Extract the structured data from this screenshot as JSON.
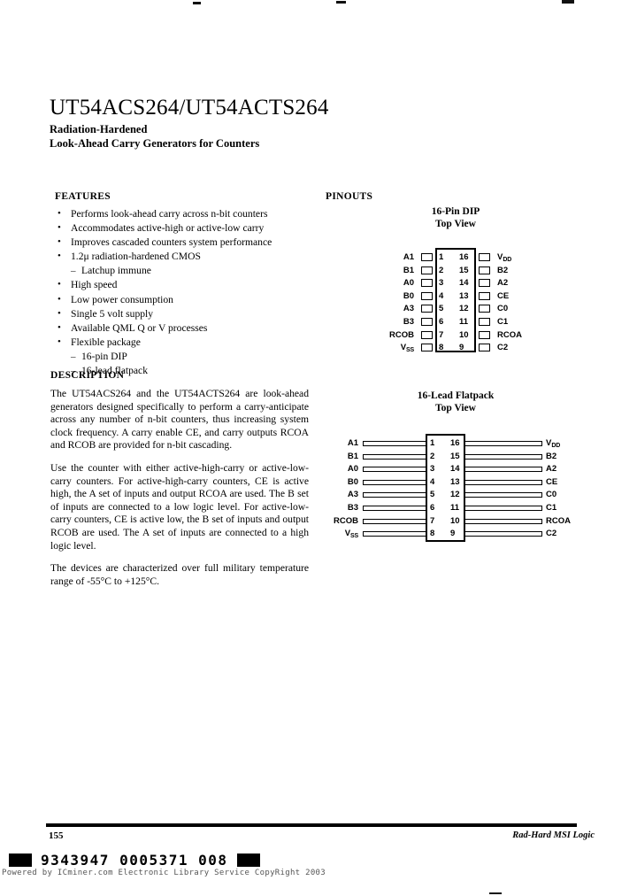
{
  "document": {
    "title": "UT54ACS264/UT54ACTS264",
    "subtitle_line1": "Radiation-Hardened",
    "subtitle_line2": "Look-Ahead Carry Generators for Counters"
  },
  "sections": {
    "features_heading": "FEATURES",
    "description_heading": "DESCRIPTION",
    "pinouts_heading": "PINOUTS"
  },
  "features": [
    {
      "type": "bullet",
      "text": "Performs look-ahead carry across n-bit counters"
    },
    {
      "type": "bullet",
      "text": "Accommodates active-high or active-low carry"
    },
    {
      "type": "bullet",
      "text": "Improves cascaded counters system performance"
    },
    {
      "type": "bullet",
      "text": "1.2μ radiation-hardened CMOS"
    },
    {
      "type": "dash",
      "text": "Latchup immune"
    },
    {
      "type": "bullet",
      "text": "High speed"
    },
    {
      "type": "bullet",
      "text": "Low power consumption"
    },
    {
      "type": "bullet",
      "text": "Single 5 volt supply"
    },
    {
      "type": "bullet",
      "text": "Available QML Q or V processes"
    },
    {
      "type": "bullet",
      "text": "Flexible package"
    },
    {
      "type": "dash",
      "text": "16-pin DIP"
    },
    {
      "type": "dash",
      "text": "16-lead flatpack"
    }
  ],
  "description": {
    "paragraph1": "The UT54ACS264 and the UT54ACTS264 are look-ahead generators designed specifically to perform a carry-anticipate across any number of n-bit counters, thus increasing system clock frequency.  A carry enable CE, and carry outputs RCOA and RCOB are provided for n-bit cascading.",
    "paragraph2": "Use the counter with either active-high-carry or active-low-carry counters.  For active-high-carry counters, CE is active high, the A set of inputs and output RCOA are used.  The B set of inputs are connected to a low logic level. For active-low-carry counters, CE is active low, the B set of inputs and output RCOB are used. The A set of inputs are connected to a high logic level.",
    "paragraph3": "The devices are characterized over full military temperature range of -55°C to +125°C."
  },
  "pinouts": {
    "dip": {
      "caption_line1": "16-Pin DIP",
      "caption_line2": "Top View",
      "rows": [
        {
          "left_label": "A1",
          "left_num": "1",
          "right_num": "16",
          "right_label": "V",
          "right_sub": "DD"
        },
        {
          "left_label": "B1",
          "left_num": "2",
          "right_num": "15",
          "right_label": "B2",
          "right_sub": ""
        },
        {
          "left_label": "A0",
          "left_num": "3",
          "right_num": "14",
          "right_label": "A2",
          "right_sub": ""
        },
        {
          "left_label": "B0",
          "left_num": "4",
          "right_num": "13",
          "right_label": "CE",
          "right_sub": ""
        },
        {
          "left_label": "A3",
          "left_num": "5",
          "right_num": "12",
          "right_label": "C0",
          "right_sub": ""
        },
        {
          "left_label": "B3",
          "left_num": "6",
          "right_num": "11",
          "right_label": "C1",
          "right_sub": ""
        },
        {
          "left_label": "RCOB",
          "left_num": "7",
          "right_num": "10",
          "right_label": "RCOA",
          "right_sub": ""
        },
        {
          "left_label": "V",
          "left_sub": "SS",
          "left_num": "8",
          "right_num": "9",
          "right_label": "C2",
          "right_sub": ""
        }
      ]
    },
    "flatpack": {
      "caption_line1": "16-Lead Flatpack",
      "caption_line2": "Top View",
      "rows": [
        {
          "left_label": "A1",
          "left_num": "1",
          "right_num": "16",
          "right_label": "V",
          "right_sub": "DD"
        },
        {
          "left_label": "B1",
          "left_num": "2",
          "right_num": "15",
          "right_label": "B2",
          "right_sub": ""
        },
        {
          "left_label": "A0",
          "left_num": "3",
          "right_num": "14",
          "right_label": "A2",
          "right_sub": ""
        },
        {
          "left_label": "B0",
          "left_num": "4",
          "right_num": "13",
          "right_label": "CE",
          "right_sub": ""
        },
        {
          "left_label": "A3",
          "left_num": "5",
          "right_num": "12",
          "right_label": "C0",
          "right_sub": ""
        },
        {
          "left_label": "B3",
          "left_num": "6",
          "right_num": "11",
          "right_label": "C1",
          "right_sub": ""
        },
        {
          "left_label": "RCOB",
          "left_num": "7",
          "right_num": "10",
          "right_label": "RCOA",
          "right_sub": ""
        },
        {
          "left_label": "V",
          "left_sub": "SS",
          "left_num": "8",
          "right_num": "9",
          "right_label": "C2",
          "right_sub": ""
        }
      ]
    }
  },
  "footer": {
    "page_number": "155",
    "right_text": "Rad-Hard MSI Logic",
    "fiche_code": "9343947 0005371 008",
    "watermark": "Powered by ICminer.com Electronic Library Service CopyRight 2003"
  }
}
